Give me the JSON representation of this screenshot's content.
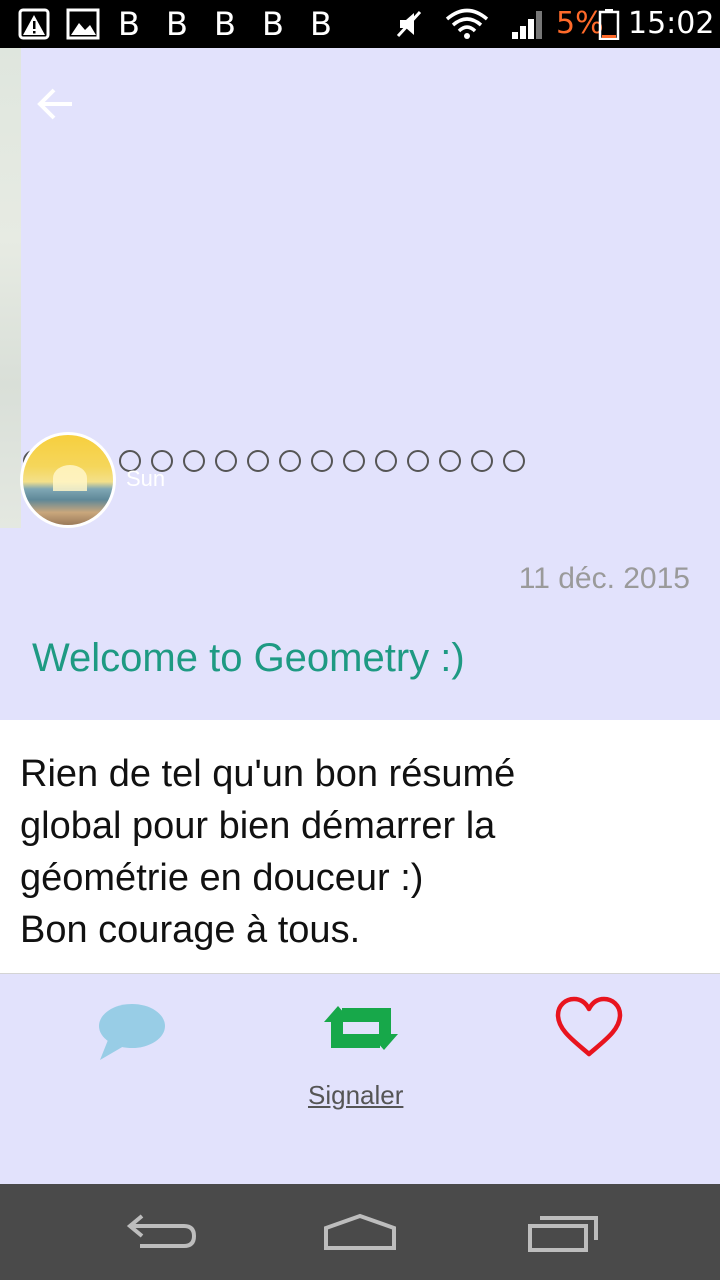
{
  "status_bar": {
    "notification_b_icons": [
      "B",
      "B",
      "B",
      "B",
      "B"
    ],
    "battery_percent": "5%",
    "time": "15:02",
    "battery_color": "#ff6a2a"
  },
  "header": {
    "back_icon": "arrow-left-icon",
    "username": "Sun",
    "carousel_dot_count": 16
  },
  "post": {
    "date": "11 déc. 2015",
    "title": "Welcome to Geometry :)",
    "title_color": "#1e9a83",
    "body": "Rien de tel qu'un bon résumé\nglobal pour bien démarrer la\ngéométrie en douceur :)\nBon courage à tous."
  },
  "actions": {
    "comment_icon": "speech-bubble-icon",
    "repost_icon": "repost-icon",
    "like_icon": "heart-icon",
    "report_label": "Signaler"
  },
  "nav_bar": {
    "back_icon": "nav-back-icon",
    "home_icon": "nav-home-icon",
    "recents_icon": "nav-recents-icon"
  }
}
